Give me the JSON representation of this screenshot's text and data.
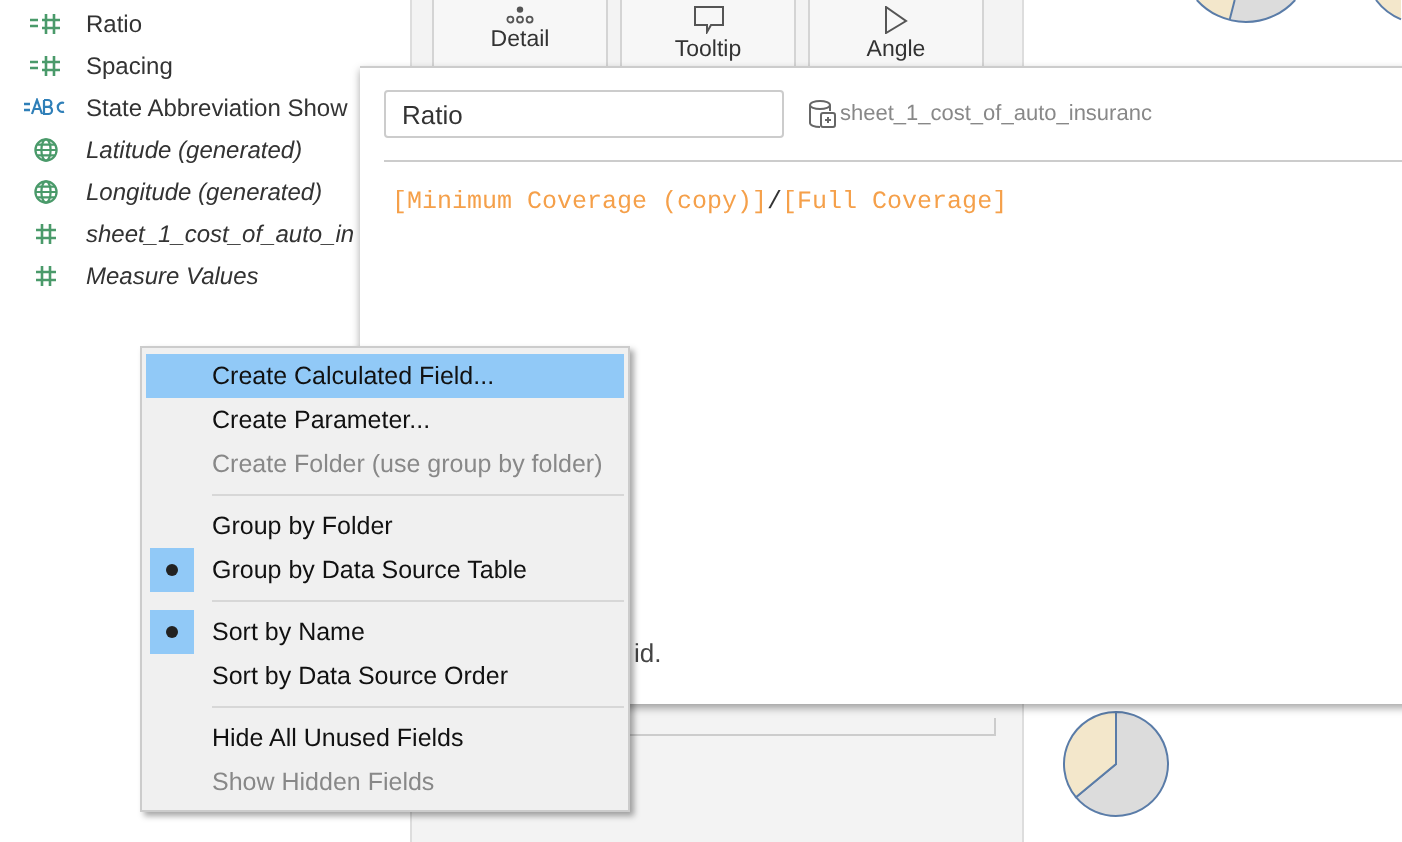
{
  "fields": [
    {
      "name": "Ratio",
      "kind": "calc-measure",
      "italic": false
    },
    {
      "name": "Spacing",
      "kind": "calc-measure",
      "italic": false
    },
    {
      "name": "State Abbreviation Show",
      "kind": "calc-dimension",
      "italic": false
    },
    {
      "name": "Latitude (generated)",
      "kind": "geo",
      "italic": true
    },
    {
      "name": "Longitude (generated)",
      "kind": "geo",
      "italic": true
    },
    {
      "name": "sheet_1_cost_of_auto_in",
      "kind": "measure",
      "italic": true
    },
    {
      "name": "Measure Values",
      "kind": "measure",
      "italic": true
    }
  ],
  "marks_buttons": [
    {
      "label": "Detail",
      "kind": "detail"
    },
    {
      "label": "Tooltip",
      "kind": "tooltip"
    },
    {
      "label": "Angle",
      "kind": "angle"
    }
  ],
  "calc_dialog": {
    "name": "Ratio",
    "data_source": "sheet_1_cost_of_auto_insuranc",
    "formula": [
      {
        "text": "[Minimum Coverage (copy)]",
        "kind": "field"
      },
      {
        "text": "/",
        "kind": "operator"
      },
      {
        "text": "[Full Coverage]",
        "kind": "field"
      }
    ],
    "status": "id."
  },
  "context_menu": [
    {
      "kind": "item",
      "label": "Create Calculated Field...",
      "highlighted": true,
      "disabled": false,
      "checked": false
    },
    {
      "kind": "item",
      "label": "Create Parameter...",
      "highlighted": false,
      "disabled": false,
      "checked": false
    },
    {
      "kind": "item",
      "label": "Create Folder (use group by folder)",
      "highlighted": false,
      "disabled": true,
      "checked": false
    },
    {
      "kind": "separator"
    },
    {
      "kind": "item",
      "label": "Group by Folder",
      "highlighted": false,
      "disabled": false,
      "checked": false
    },
    {
      "kind": "item",
      "label": "Group by Data Source Table",
      "highlighted": false,
      "disabled": false,
      "checked": true
    },
    {
      "kind": "separator"
    },
    {
      "kind": "item",
      "label": "Sort by Name",
      "highlighted": false,
      "disabled": false,
      "checked": true
    },
    {
      "kind": "item",
      "label": "Sort by Data Source Order",
      "highlighted": false,
      "disabled": false,
      "checked": false
    },
    {
      "kind": "separator"
    },
    {
      "kind": "item",
      "label": "Hide All Unused Fields",
      "highlighted": false,
      "disabled": false,
      "checked": false
    },
    {
      "kind": "item",
      "label": "Show Hidden Fields",
      "highlighted": false,
      "disabled": true,
      "checked": false
    }
  ]
}
